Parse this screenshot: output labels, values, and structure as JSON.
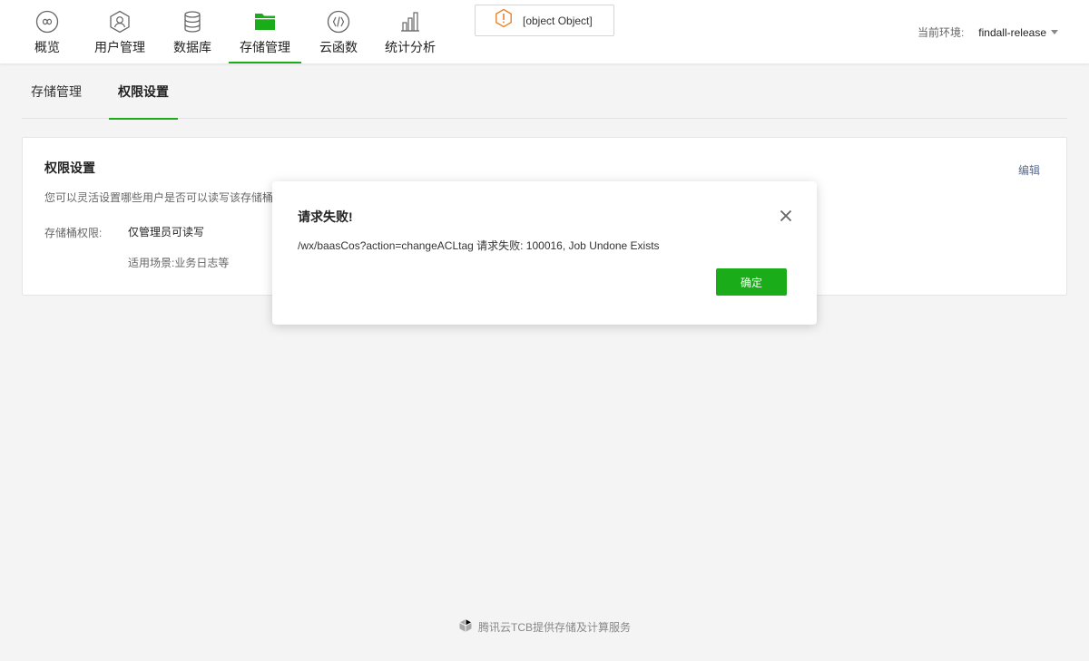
{
  "nav": {
    "items": [
      {
        "label": "概览",
        "icon": "infinity-icon"
      },
      {
        "label": "用户管理",
        "icon": "user-icon"
      },
      {
        "label": "数据库",
        "icon": "database-icon"
      },
      {
        "label": "存储管理",
        "icon": "folder-icon",
        "active": true
      },
      {
        "label": "云函数",
        "icon": "function-icon"
      },
      {
        "label": "统计分析",
        "icon": "bar-chart-icon"
      }
    ],
    "alert_text": "[object Object]",
    "env_label": "当前环境:",
    "env_value": "findall-release"
  },
  "subtabs": [
    {
      "label": "存储管理"
    },
    {
      "label": "权限设置",
      "active": true
    }
  ],
  "card": {
    "title": "权限设置",
    "edit_label": "编辑",
    "description": "您可以灵活设置哪些用户是否可以读写该存储桶",
    "permission_label": "存储桶权限:",
    "permission_value": "仅管理员可读写",
    "scene": "适用场景:业务日志等"
  },
  "modal": {
    "title": "请求失败!",
    "message": "/wx/baasCos?action=changeACLtag 请求失败: 100016, Job Undone Exists",
    "ok_label": "确定"
  },
  "footer": {
    "text": "腾讯云TCB提供存储及计算服务"
  },
  "colors": {
    "accent": "#1aad19",
    "link": "#576b95",
    "alert_icon": "#e8832a"
  }
}
